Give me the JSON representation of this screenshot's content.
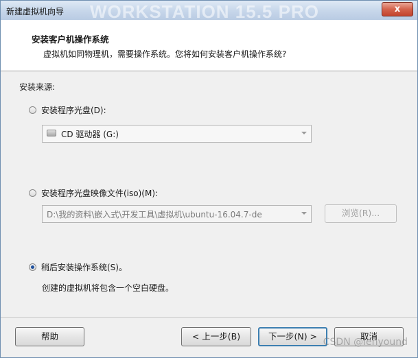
{
  "window": {
    "title": "新建虚拟机向导",
    "watermark": "WORKSTATION 15.5 PRO",
    "close_label": "x"
  },
  "header": {
    "title": "安装客户机操作系统",
    "subtitle": "虚拟机如同物理机，需要操作系统。您将如何安装客户机操作系统?"
  },
  "main": {
    "source_label": "安装来源:",
    "options": [
      {
        "label": "安装程序光盘(D):",
        "checked": false
      },
      {
        "label": "安装程序光盘映像文件(iso)(M):",
        "checked": false
      },
      {
        "label": "稍后安装操作系统(S)。",
        "checked": true
      }
    ],
    "cd_drive": {
      "value": "CD 驱动器 (G:)",
      "icon": "cd-drive-icon"
    },
    "iso_path": {
      "value": "D:\\我的资料\\嵌入式\\开发工具\\虚拟机\\ubuntu-16.04.7-de"
    },
    "browse_label": "浏览(R)...",
    "later_note": "创建的虚拟机将包含一个空白硬盘。"
  },
  "footer": {
    "help": "帮助",
    "back": "< 上一步(B)",
    "next": "下一步(N) >",
    "cancel": "取消"
  },
  "credit": "CSDN @lenyound"
}
